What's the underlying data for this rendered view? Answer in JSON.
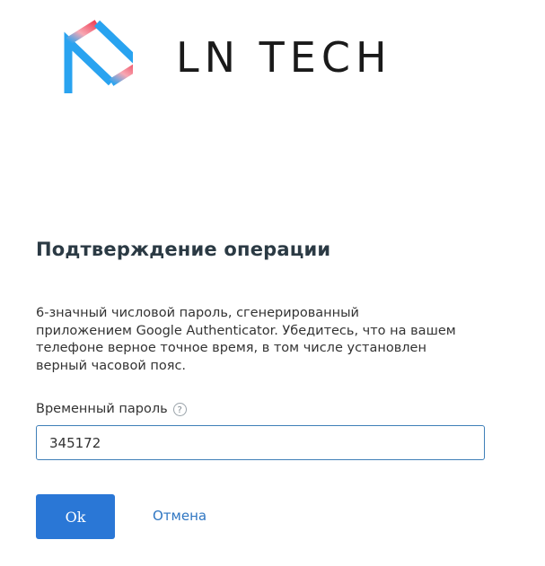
{
  "logo": {
    "text": "LN TECH",
    "colors": {
      "blue": "#29a3f0",
      "red": "#f0455a",
      "text": "#1a1a1a"
    }
  },
  "dialog": {
    "title": "Подтверждение операции",
    "description": "6-значный числовой пароль, сгенерированный приложением Google Authenticator. Убедитесь, что на вашем телефоне верное точное время, в том числе установлен верный часовой пояс.",
    "field_label": "Временный пароль",
    "help_icon_glyph": "?",
    "password_value": "345172",
    "ok_label": "Ok",
    "cancel_label": "Отмена"
  },
  "colors": {
    "accent": "#2a77d6",
    "link": "#2f76c2",
    "input_border": "#3f7fb8",
    "title": "#2b3a44"
  }
}
